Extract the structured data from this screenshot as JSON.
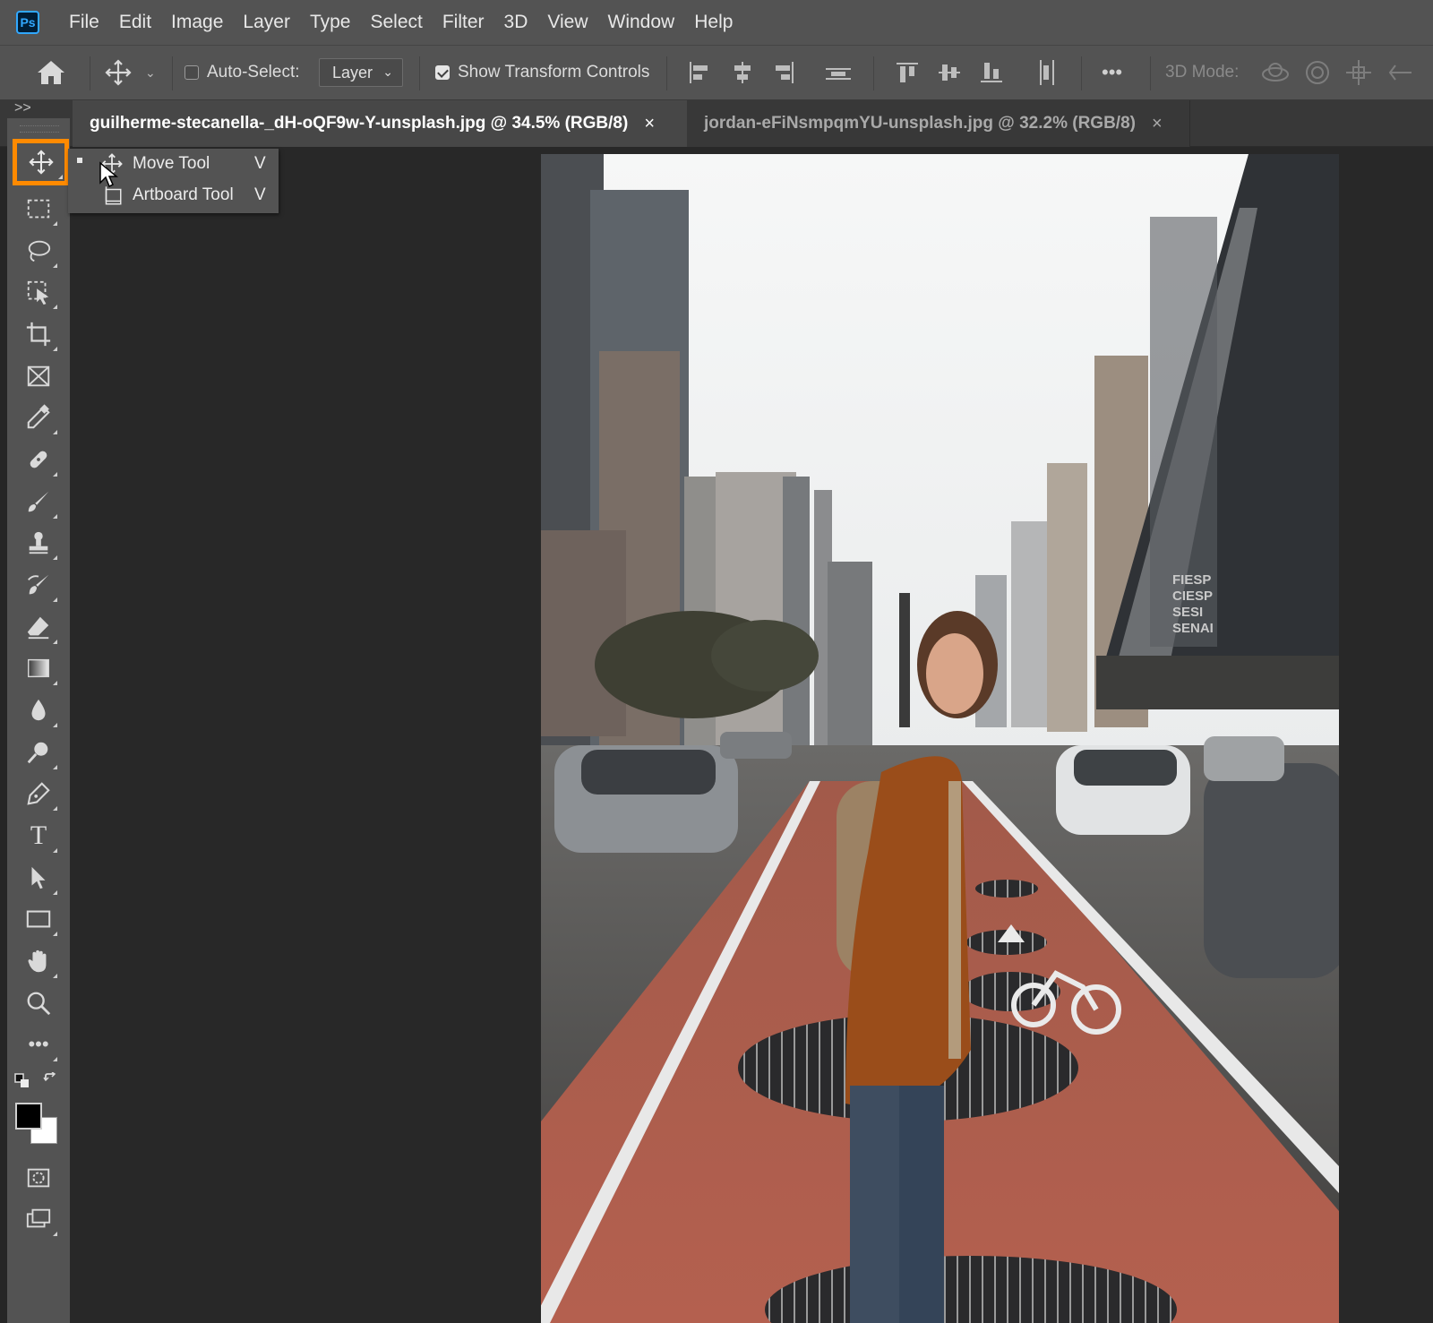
{
  "app": {
    "logo_text": "Ps"
  },
  "menu": [
    "File",
    "Edit",
    "Image",
    "Layer",
    "Type",
    "Select",
    "Filter",
    "3D",
    "View",
    "Window",
    "Help"
  ],
  "options_bar": {
    "auto_select_label": "Auto-Select:",
    "auto_select_checked": false,
    "auto_select_target": "Layer",
    "show_transform_label": "Show Transform Controls",
    "show_transform_checked": true,
    "more_label": "•••",
    "mode_3d_label": "3D Mode:"
  },
  "tabs": [
    {
      "label": "guilherme-stecanella-_dH-oQF9w-Y-unsplash.jpg @ 34.5% (RGB/8)",
      "active": true,
      "close": "×"
    },
    {
      "label": "jordan-eFiNsmpqmYU-unsplash.jpg @ 32.2% (RGB/8)",
      "active": false,
      "close": "×"
    }
  ],
  "panel_collapse_label": ">>",
  "tools": [
    "move-tool",
    "rectangular-marquee-tool",
    "lasso-tool",
    "object-selection-tool",
    "crop-tool",
    "frame-tool",
    "eyedropper-tool",
    "healing-brush-tool",
    "brush-tool",
    "clone-stamp-tool",
    "history-brush-tool",
    "eraser-tool",
    "gradient-tool",
    "blur-tool",
    "dodge-tool",
    "pen-tool",
    "type-tool",
    "path-selection-tool",
    "rectangle-tool",
    "hand-tool",
    "zoom-tool",
    "edit-toolbar"
  ],
  "toolbar_more_label": "•••",
  "type_tool_glyph": "T",
  "flyout": {
    "items": [
      {
        "label": "Move Tool",
        "shortcut": "V",
        "selected": true
      },
      {
        "label": "Artboard Tool",
        "shortcut": "V",
        "selected": false
      }
    ]
  },
  "colors": {
    "foreground": "#000000",
    "background": "#ffffff",
    "highlight": "#ff8a00"
  },
  "photo": {
    "sign_lines": [
      "FIESP",
      "CIESP",
      "SESI",
      "SENAI"
    ]
  }
}
